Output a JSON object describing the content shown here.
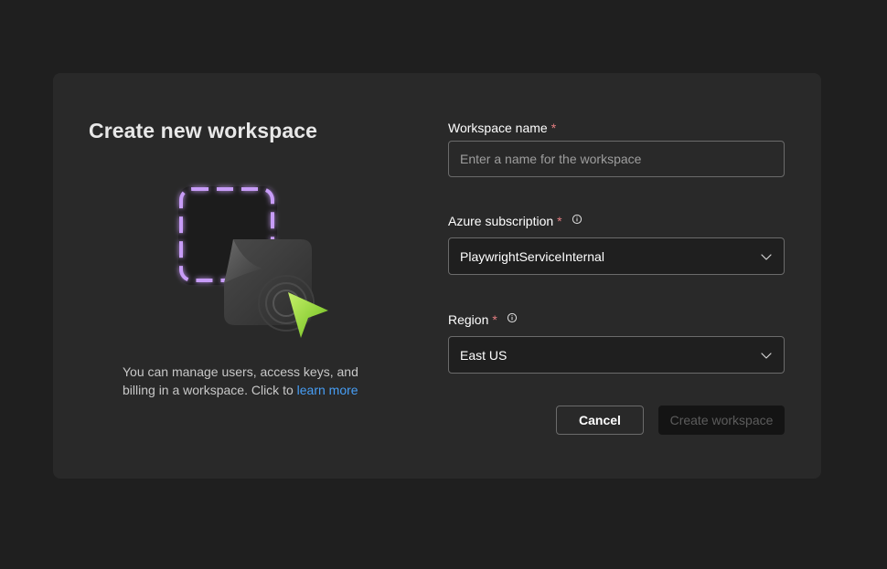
{
  "dialog": {
    "title": "Create new workspace",
    "description_text": "You can manage users, access keys, and billing in a workspace. Click to ",
    "learn_more_label": "learn more",
    "illustration_icon": "workspace-illustration-icon"
  },
  "form": {
    "workspace_name": {
      "label": "Workspace name",
      "required_marker": "*",
      "placeholder": "Enter a name for the workspace",
      "value": ""
    },
    "subscription": {
      "label": "Azure subscription",
      "required_marker": "*",
      "info_icon": "info-icon",
      "selected": "PlaywrightServiceInternal",
      "chevron_icon": "chevron-down-icon"
    },
    "region": {
      "label": "Region",
      "required_marker": "*",
      "info_icon": "info-icon",
      "selected": "East US",
      "chevron_icon": "chevron-down-icon"
    }
  },
  "actions": {
    "cancel_label": "Cancel",
    "create_label": "Create workspace"
  },
  "colors": {
    "page_background": "#1f1f1f",
    "dialog_background": "#292929",
    "link": "#479ef5",
    "required": "#e37d80",
    "accent_purple": "#c79cf7",
    "accent_green": "#8fd13a"
  }
}
